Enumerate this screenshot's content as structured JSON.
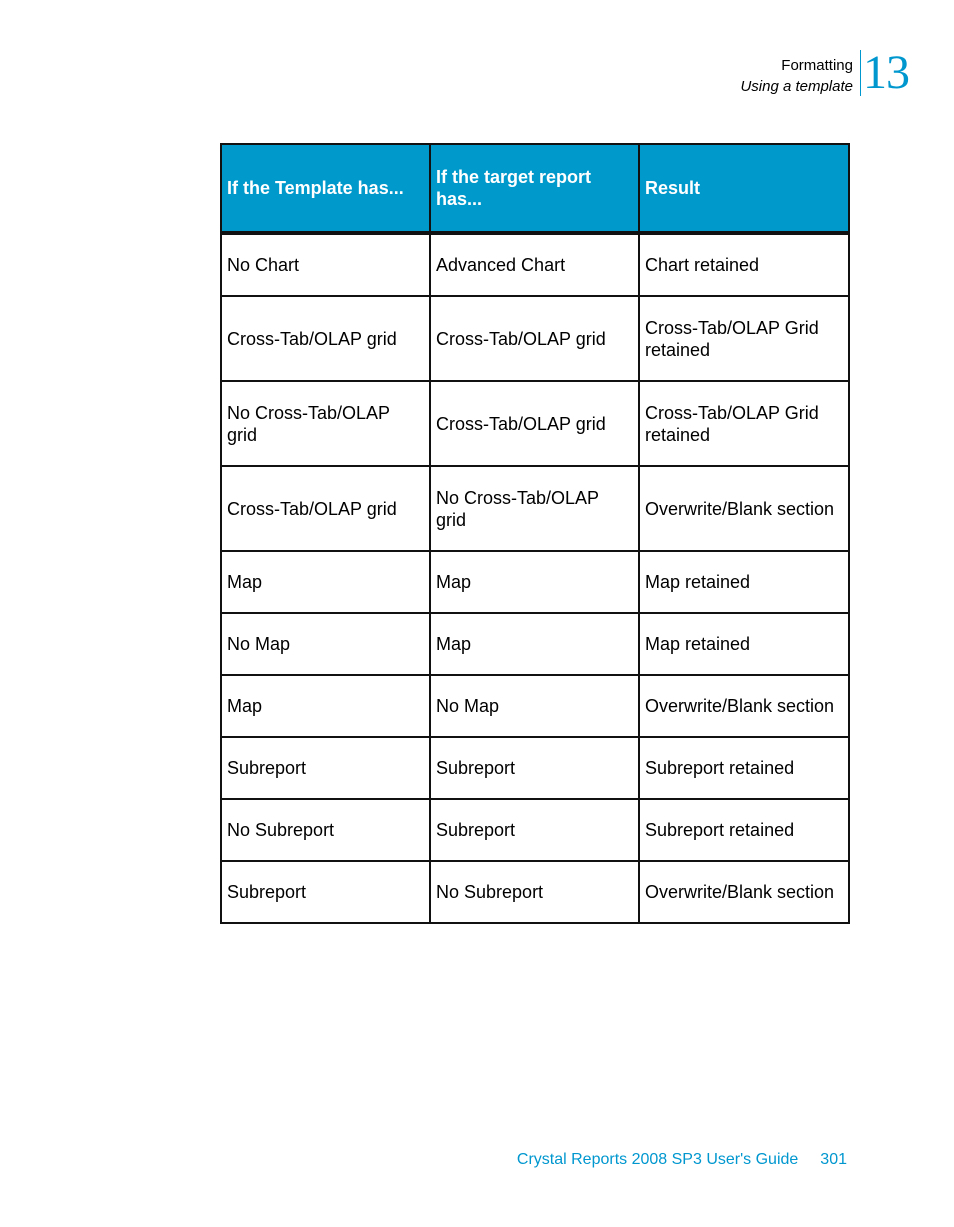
{
  "running_head": {
    "chapter_title": "Formatting",
    "section_title": "Using a template",
    "chapter_number": "13"
  },
  "table": {
    "headers": [
      "If the Template has...",
      "If the target report has...",
      "Result"
    ],
    "rows": [
      [
        "No Chart",
        "Advanced Chart",
        "Chart retained"
      ],
      [
        "Cross-Tab/OLAP grid",
        "Cross-Tab/OLAP grid",
        "Cross-Tab/OLAP Grid retained"
      ],
      [
        "No Cross-Tab/OLAP grid",
        "Cross-Tab/OLAP grid",
        "Cross-Tab/OLAP Grid retained"
      ],
      [
        "Cross-Tab/OLAP grid",
        "No Cross-Tab/OLAP grid",
        "Overwrite/Blank section"
      ],
      [
        "Map",
        "Map",
        "Map retained"
      ],
      [
        "No Map",
        "Map",
        "Map retained"
      ],
      [
        "Map",
        "No Map",
        "Overwrite/Blank section"
      ],
      [
        "Subreport",
        "Subreport",
        "Subreport retained"
      ],
      [
        "No Subreport",
        "Subreport",
        "Subreport retained"
      ],
      [
        "Subreport",
        "No Subreport",
        "Overwrite/Blank section"
      ]
    ]
  },
  "footer": {
    "book_title": "Crystal Reports 2008 SP3 User's Guide",
    "page_number": "301"
  },
  "colors": {
    "accent": "#0097cf",
    "header_background": "#0099cc",
    "header_text": "#ffffff",
    "border": "#111111"
  }
}
